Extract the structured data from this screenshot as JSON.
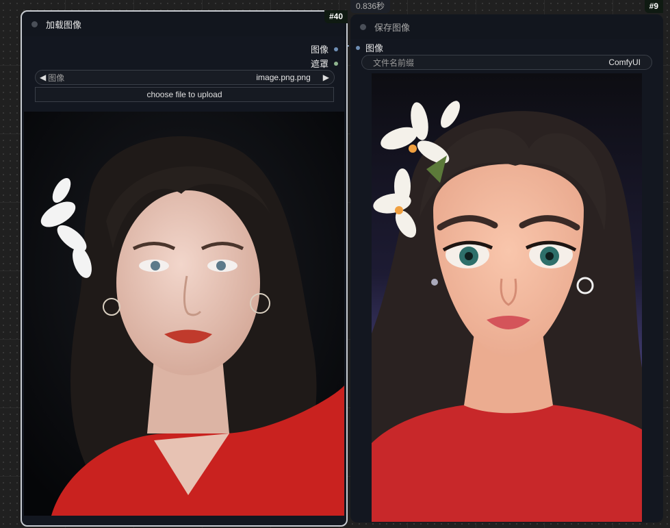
{
  "run": {
    "elapsed": "0.836秒"
  },
  "load_node": {
    "id": "#40",
    "title": "加载图像",
    "outputs": [
      {
        "label": "图像",
        "color": "#6f8fb5"
      },
      {
        "label": "遮罩",
        "color": "#8fb58f"
      }
    ],
    "image_widget": {
      "label": "图像",
      "value": "image.png.png",
      "prev_icon": "◀",
      "next_icon": "▶"
    },
    "upload_button": "choose file to upload",
    "preview_image": "photo-woman-red-top-flower-in-hair"
  },
  "save_node": {
    "id": "#9",
    "title": "保存图像",
    "inputs": [
      {
        "label": "图像",
        "color": "#6f8fb5"
      }
    ],
    "filename_widget": {
      "label": "文件名前缀",
      "value": "ComfyUI"
    },
    "preview_image": "cartoon-woman-red-top-flower-in-hair"
  }
}
